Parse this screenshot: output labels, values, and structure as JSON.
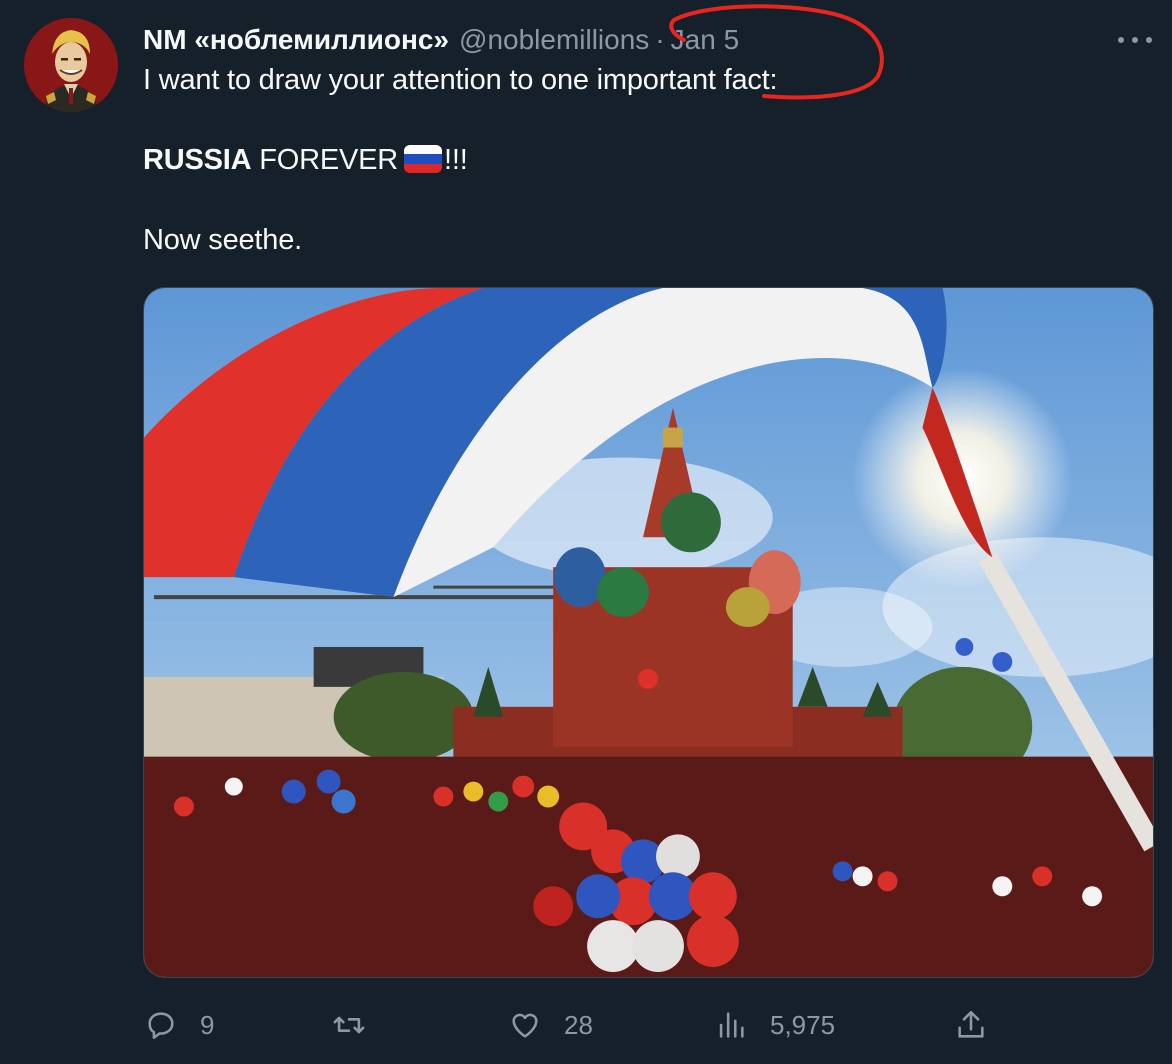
{
  "tweet": {
    "display_name": "NM «ноблемиллионс»",
    "handle": "@noblemillions",
    "separator": "·",
    "date": "Jan 5",
    "text": {
      "line1": "I want to draw your attention to one important fact:",
      "line2_bold": "RUSSIA",
      "line2_rest": " FOREVER",
      "line2_end": "!!!",
      "line3": "Now seethe."
    },
    "flag_colors": [
      "#ffffff",
      "#1f4fbf",
      "#e1262a"
    ],
    "media_icon": "russia-red-square-photo",
    "annotation_color": "#e8261e"
  },
  "actions": {
    "reply_count": "9",
    "retweet_count": "",
    "like_count": "28",
    "views_count": "5,975"
  },
  "icons": [
    "more-icon",
    "reply-icon",
    "retweet-icon",
    "like-icon",
    "views-icon",
    "share-icon"
  ]
}
